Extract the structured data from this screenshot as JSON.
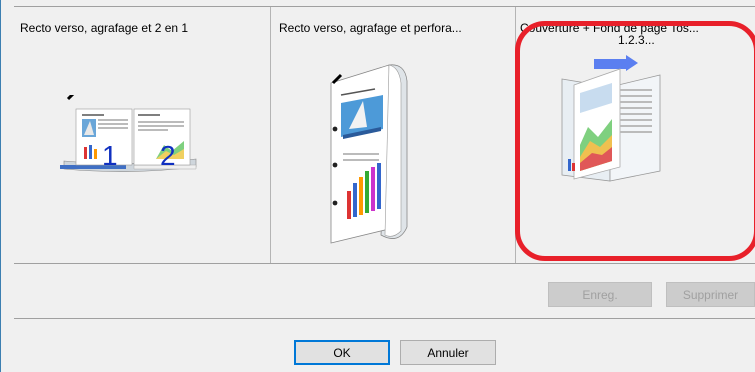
{
  "presets": [
    {
      "label": "Recto verso, agrafage et 2 en 1",
      "page_numbers": [
        "1",
        "2"
      ]
    },
    {
      "label": "Recto verso, agrafage et perfora..."
    },
    {
      "label": "Couverture + Fond de page Tos...",
      "sub_label": "1.2.3..."
    }
  ],
  "buttons": {
    "save": "Enreg.",
    "delete": "Supprimer",
    "ok": "OK",
    "cancel": "Annuler"
  },
  "colors": {
    "selection": "#e8202a",
    "focus": "#0078d7"
  }
}
